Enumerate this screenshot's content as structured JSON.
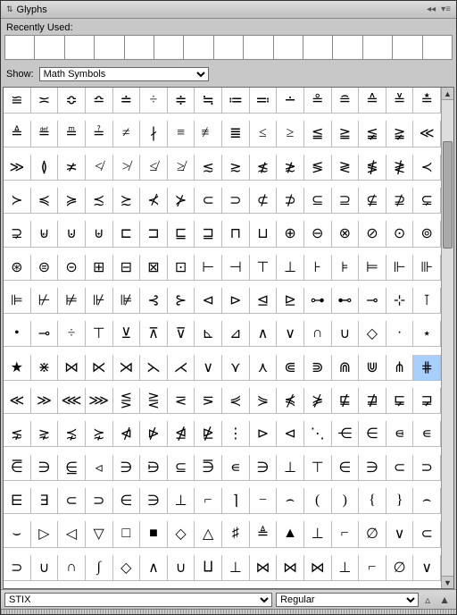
{
  "title": "Glyphs",
  "recent_label": "Recently Used:",
  "show_label": "Show:",
  "show_value": "Math Symbols",
  "font_value": "STIX",
  "style_value": "Regular",
  "selected_index": 143,
  "glyphs": [
    "≌",
    "≍",
    "≎",
    "≏",
    "≐",
    "÷",
    "≑",
    "≒",
    "≔",
    "≕",
    "∸",
    "≗",
    "≘",
    "≙",
    "≚",
    "≛",
    "≜",
    "≝",
    "≞",
    "≟",
    "≠",
    "∤",
    "≡",
    "≢",
    "≣",
    "≤",
    "≥",
    "≦",
    "≧",
    "≨",
    "≩",
    "≪",
    "≫",
    "≬",
    "≭",
    "≮",
    "≯",
    "≰",
    "≱",
    "≲",
    "≳",
    "≴",
    "≵",
    "≶",
    "≷",
    "≸",
    "≹",
    "≺",
    "≻",
    "≼",
    "≽",
    "≾",
    "≿",
    "⊀",
    "⊁",
    "⊂",
    "⊃",
    "⊄",
    "⊅",
    "⊆",
    "⊇",
    "⊈",
    "⊉",
    "⊊",
    "⊋",
    "⊌",
    "⊍",
    "⊎",
    "⊏",
    "⊐",
    "⊑",
    "⊒",
    "⊓",
    "⊔",
    "⊕",
    "⊖",
    "⊗",
    "⊘",
    "⊙",
    "⊚",
    "⊛",
    "⊜",
    "⊝",
    "⊞",
    "⊟",
    "⊠",
    "⊡",
    "⊢",
    "⊣",
    "⊤",
    "⊥",
    "⊦",
    "⊧",
    "⊨",
    "⊩",
    "⊪",
    "⊫",
    "⊬",
    "⊭",
    "⊮",
    "⊯",
    "⊰",
    "⊱",
    "⊲",
    "⊳",
    "⊴",
    "⊵",
    "⊶",
    "⊷",
    "⊸",
    "⊹",
    "⊺",
    "•",
    "⊸",
    "÷",
    "⊤",
    "⊻",
    "⊼",
    "⊽",
    "⊾",
    "⊿",
    "∧",
    "∨",
    "∩",
    "∪",
    "◇",
    "∙",
    "⋆",
    "★",
    "⋇",
    "⋈",
    "⋉",
    "⋊",
    "⋋",
    "⋌",
    "∨",
    "⋎",
    "⋏",
    "⋐",
    "⋑",
    "⋒",
    "⋓",
    "⋔",
    "⋕",
    "≪",
    "≫",
    "⋘",
    "⋙",
    "⋚",
    "⋛",
    "⋜",
    "⋝",
    "⋞",
    "⋟",
    "⋠",
    "⋡",
    "⋢",
    "⋣",
    "⋤",
    "⋥",
    "⋦",
    "⋧",
    "⋨",
    "⋩",
    "⋪",
    "⋫",
    "⋬",
    "⋭",
    "⋮",
    "⊳",
    "⊲",
    "⋱",
    "⋲",
    "∈",
    "⋴",
    "∊",
    "⋶",
    "∋",
    "⋸",
    "◃",
    "∋",
    "⋻",
    "⊆",
    "⋽",
    "∊",
    "∋",
    "⊥",
    "⊤",
    "∈",
    "∋",
    "⊂",
    "⊃",
    "⋿",
    "∃",
    "⊂",
    "⊃",
    "∈",
    "∋",
    "⊥",
    "⌐",
    "⌉",
    "−",
    "⌢",
    "(",
    ")",
    "{",
    "}",
    "⌢",
    "⌣",
    "▷",
    "◁",
    "▽",
    "□",
    "■",
    "◇",
    "△",
    "♯",
    "≜",
    "▲",
    "⊥",
    "⌐",
    "∅",
    "∨",
    "⊂",
    "⊃",
    "∪",
    "∩",
    "∫",
    "◇",
    "∧",
    "∪",
    "⨿",
    "⊥",
    "⋈",
    "⋈",
    "⋈",
    "⊥",
    "⌐",
    "∅",
    "∨"
  ]
}
